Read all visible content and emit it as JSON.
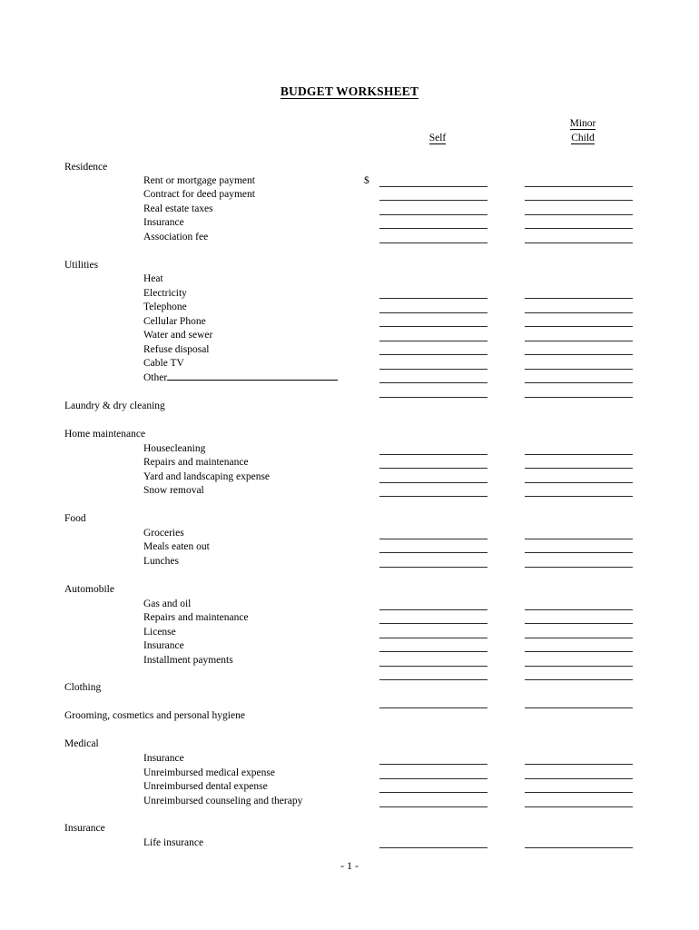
{
  "document": {
    "title": "BUDGET WORKSHEET",
    "page_number": "- 1 -",
    "currency_symbol": "$"
  },
  "columns": {
    "self": "Self",
    "minor_line1": "Minor",
    "minor_line2": "Child"
  },
  "sections": [
    {
      "name": "Residence",
      "items": [
        "Rent or mortgage payment",
        "Contract for deed payment",
        "Real estate taxes",
        "Insurance",
        "Association fee"
      ]
    },
    {
      "name": "Utilities",
      "items": [
        "Heat",
        "Electricity",
        "Telephone",
        "Cellular Phone",
        "Water and sewer",
        "Refuse disposal",
        "Cable TV",
        "Other"
      ]
    },
    {
      "name": "Laundry & dry cleaning",
      "items": []
    },
    {
      "name": "Home maintenance",
      "items": [
        "Housecleaning",
        "Repairs and maintenance",
        "Yard and landscaping expense",
        "Snow removal"
      ]
    },
    {
      "name": "Food",
      "items": [
        "Groceries",
        "Meals eaten out",
        "Lunches"
      ]
    },
    {
      "name": "Automobile",
      "items": [
        "Gas and oil",
        "Repairs and maintenance",
        "License",
        "Insurance",
        "Installment payments"
      ]
    },
    {
      "name": "Clothing",
      "items": []
    },
    {
      "name": "Grooming, cosmetics and personal hygiene",
      "items": []
    },
    {
      "name": "Medical",
      "items": [
        "Insurance",
        "Unreimbursed medical expense",
        "Unreimbursed dental expense",
        "Unreimbursed counseling and therapy"
      ]
    },
    {
      "name": "Insurance",
      "items": [
        "Life insurance"
      ]
    }
  ]
}
